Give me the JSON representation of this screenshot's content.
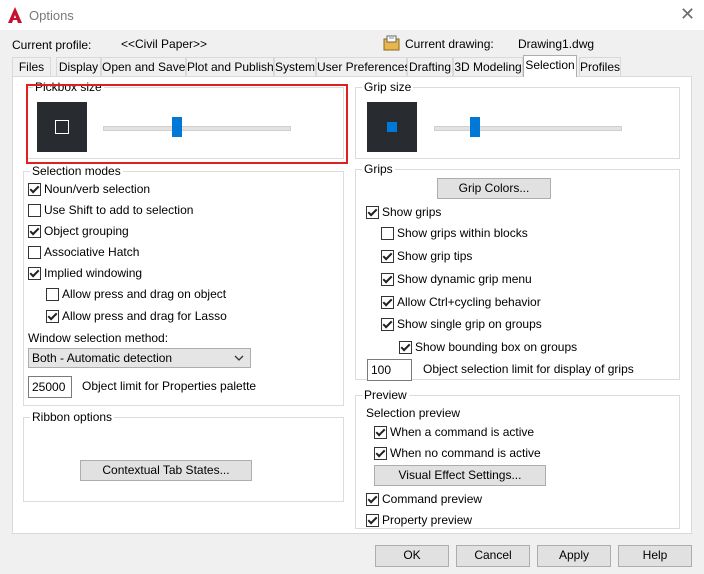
{
  "window": {
    "title": "Options"
  },
  "profile": {
    "label": "Current profile:",
    "value": "<<Civil Paper>>"
  },
  "drawing": {
    "label": "Current drawing:",
    "value": "Drawing1.dwg"
  },
  "tabs": [
    "Files",
    "Display",
    "Open and Save",
    "Plot and Publish",
    "System",
    "User Preferences",
    "Drafting",
    "3D Modeling",
    "Selection",
    "Profiles"
  ],
  "active_tab": "Selection",
  "pickbox": {
    "title": "Pickbox size",
    "level": 0.4
  },
  "grip_size": {
    "title": "Grip size",
    "level": 0.22
  },
  "selection_modes": {
    "title": "Selection modes",
    "items": [
      {
        "label": "Noun/verb selection",
        "checked": true
      },
      {
        "label": "Use Shift to add to selection",
        "checked": false
      },
      {
        "label": "Object grouping",
        "checked": true
      },
      {
        "label": "Associative Hatch",
        "checked": false
      },
      {
        "label": "Implied windowing",
        "checked": true
      },
      {
        "label": "Allow press and drag on object",
        "checked": false
      },
      {
        "label": "Allow press and drag for Lasso",
        "checked": true
      }
    ],
    "window_method_label": "Window selection method:",
    "window_method_value": "Both - Automatic detection",
    "object_limit_value": "25000",
    "object_limit_label": "Object limit for Properties palette"
  },
  "ribbon": {
    "title": "Ribbon options",
    "button": "Contextual Tab States..."
  },
  "grips": {
    "title": "Grips",
    "colors_button": "Grip Colors...",
    "items": [
      {
        "label": "Show grips",
        "checked": true
      },
      {
        "label": "Show grips within blocks",
        "checked": false
      },
      {
        "label": "Show grip tips",
        "checked": true
      },
      {
        "label": "Show dynamic grip menu",
        "checked": true
      },
      {
        "label": "Allow Ctrl+cycling behavior",
        "checked": true
      },
      {
        "label": "Show single grip on groups",
        "checked": true
      },
      {
        "label": "Show bounding box on groups",
        "checked": true
      }
    ],
    "limit_value": "100",
    "limit_label": "Object selection limit for display of grips"
  },
  "preview": {
    "title": "Preview",
    "subtitle": "Selection preview",
    "items": [
      {
        "label": "When a command is active",
        "checked": true
      },
      {
        "label": "When no command is active",
        "checked": true
      }
    ],
    "visual_button": "Visual Effect Settings...",
    "extra": [
      {
        "label": "Command preview",
        "checked": true
      },
      {
        "label": "Property preview",
        "checked": true
      }
    ]
  },
  "footer": {
    "ok": "OK",
    "cancel": "Cancel",
    "apply": "Apply",
    "help": "Help"
  },
  "colors": {
    "accent": "#0078d7",
    "swatch": "#282b30",
    "highlight": "#e02020"
  }
}
